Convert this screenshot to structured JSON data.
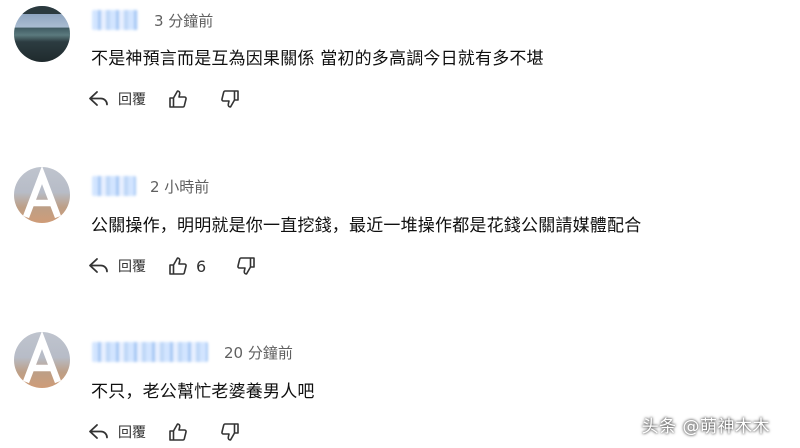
{
  "comments": [
    {
      "author": "",
      "time": "3 分鐘前",
      "text": "不是神預言而是互為因果關係 當初的多高調今日就有多不堪",
      "reply_label": "回覆",
      "like_count": ""
    },
    {
      "author": "",
      "avatar_letter": "A",
      "time": "2 小時前",
      "text": "公關操作，明明就是你一直挖錢，最近一堆操作都是花錢公關請媒體配合",
      "reply_label": "回覆",
      "like_count": "6"
    },
    {
      "author": "",
      "avatar_letter": "A",
      "time": "20 分鐘前",
      "text": "不只，老公幫忙老婆養男人吧",
      "reply_label": "回覆",
      "like_count": ""
    }
  ],
  "watermark": "头条 @萌神木木",
  "colors": {
    "text": "#0f0f0f",
    "meta": "#606060",
    "icon": "#333333"
  },
  "icons": [
    "reply-icon",
    "thumbs-up-icon",
    "thumbs-down-icon"
  ]
}
